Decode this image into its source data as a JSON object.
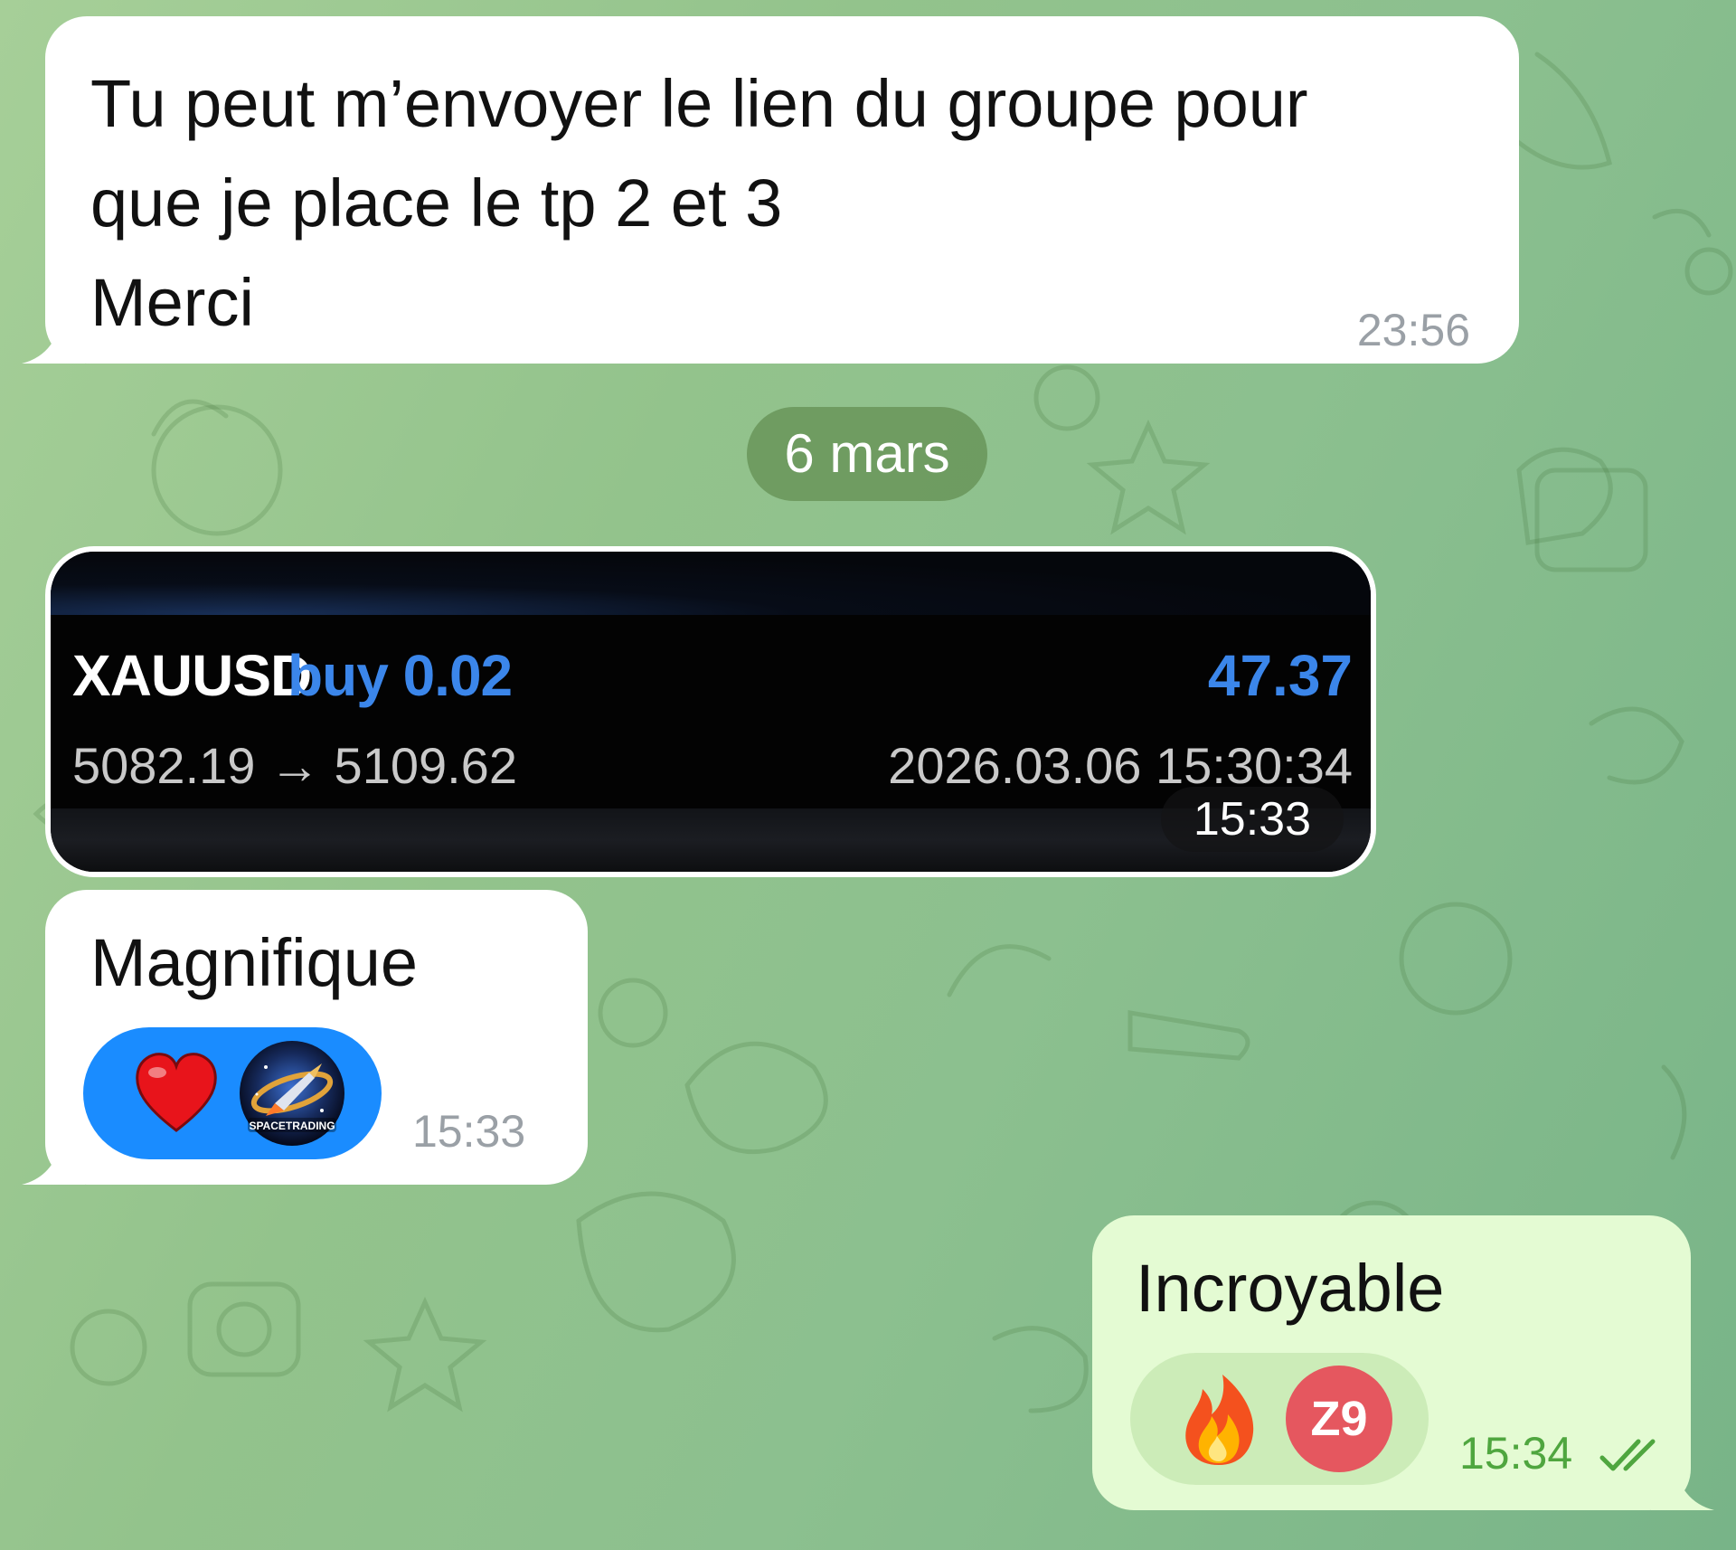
{
  "colors": {
    "incoming_bubble": "#ffffff",
    "outgoing_bubble": "#e4fbd3",
    "reaction_selected": "#1a8cff",
    "accent_blue": "#3b86ea",
    "time_outgoing": "#4fa63f"
  },
  "messages": [
    {
      "direction": "incoming",
      "lines": [
        "Tu peut m’envoyer le lien du groupe pour",
        "que je place le tp 2 et 3",
        "Merci"
      ],
      "time": "23:56"
    },
    {
      "type": "date-separator",
      "label": "6 mars"
    },
    {
      "direction": "incoming",
      "type": "photo",
      "trade": {
        "symbol": "XAUUSD",
        "direction_volume": "buy 0.02",
        "profit": "47.37",
        "prices": "5082.19 → 5109.62",
        "datetime": "2026.03.06 15:30:34"
      },
      "time": "15:33"
    },
    {
      "direction": "incoming",
      "text": "Magnifique",
      "reactions": [
        {
          "emoji": "❤️",
          "icon": "heart-icon"
        },
        {
          "avatar": "SPACETRADING",
          "icon": "space-trading-avatar"
        }
      ],
      "time": "15:33"
    },
    {
      "direction": "outgoing",
      "text": "Incroyable",
      "reactions": [
        {
          "emoji": "🔥",
          "icon": "fire-icon"
        },
        {
          "avatar_initials": "Z9",
          "avatar_color": "#e5575f"
        }
      ],
      "time": "15:34",
      "status_icon": "double-check-icon"
    }
  ]
}
